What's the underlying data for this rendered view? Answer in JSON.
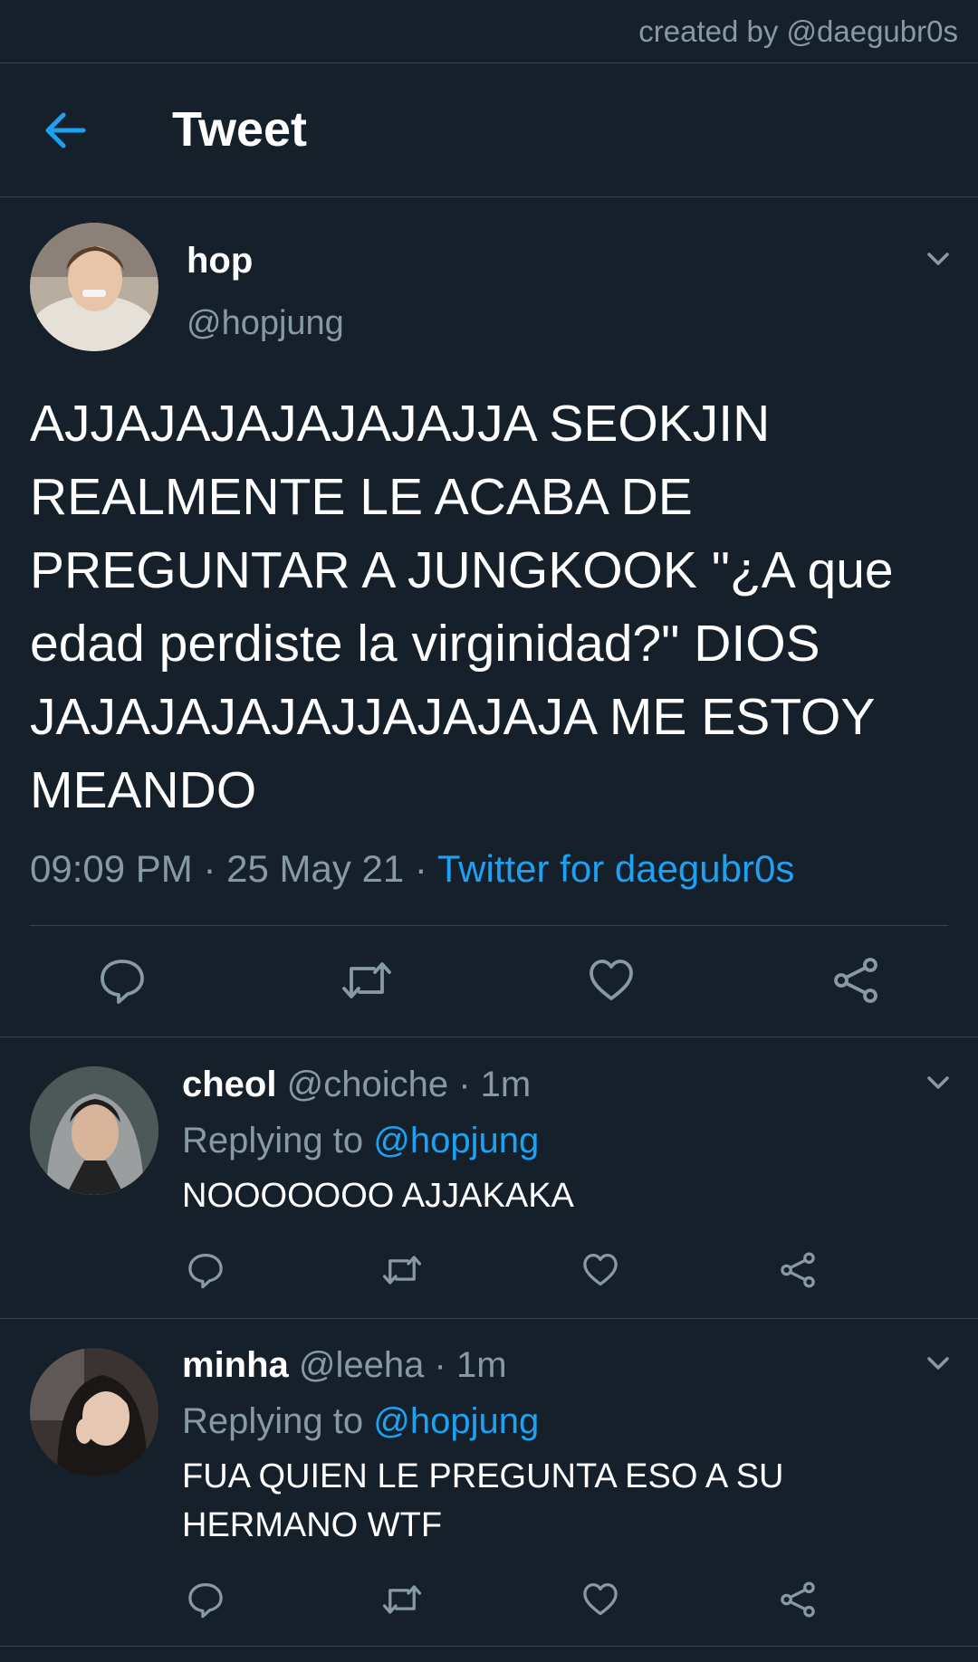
{
  "credit": "created by @daegubr0s",
  "header": {
    "title": "Tweet"
  },
  "tweet": {
    "author_name": "hop",
    "author_handle": "@hopjung",
    "text": "AJJAJAJAJAJAJAJJA SEOKJIN REALMENTE LE ACABA DE PREGUNTAR A JUNGKOOK \"¿A que edad perdiste la virginidad?\" DIOS JAJAJAJAJAJJAJAJAJA ME ESTOY MEANDO",
    "time": "09:09 PM",
    "separator": " · ",
    "date": "25 May 21",
    "source": "Twitter for daegubr0s"
  },
  "replies": [
    {
      "name": "cheol",
      "handle": "@choiche",
      "time_sep": " · ",
      "time": "1m",
      "replying_label": "Replying to ",
      "mention": "@hopjung",
      "text": "NOOOOOOO AJJAKAKA"
    },
    {
      "name": "minha",
      "handle": "@leeha",
      "time_sep": " · ",
      "time": "1m",
      "replying_label": "Replying to ",
      "mention": "@hopjung",
      "text": "FUA QUIEN LE PREGUNTA ESO A SU HERMANO WTF"
    }
  ],
  "icons": {
    "back": "arrow-left-icon",
    "caret": "chevron-down-icon",
    "reply": "speech-bubble-icon",
    "retweet": "retweet-icon",
    "like": "heart-icon",
    "share": "share-icon"
  },
  "colors": {
    "background": "#15202b",
    "divider": "#38444d",
    "secondary_text": "#8899a6",
    "accent": "#1da1f2",
    "primary_text": "#ffffff"
  }
}
